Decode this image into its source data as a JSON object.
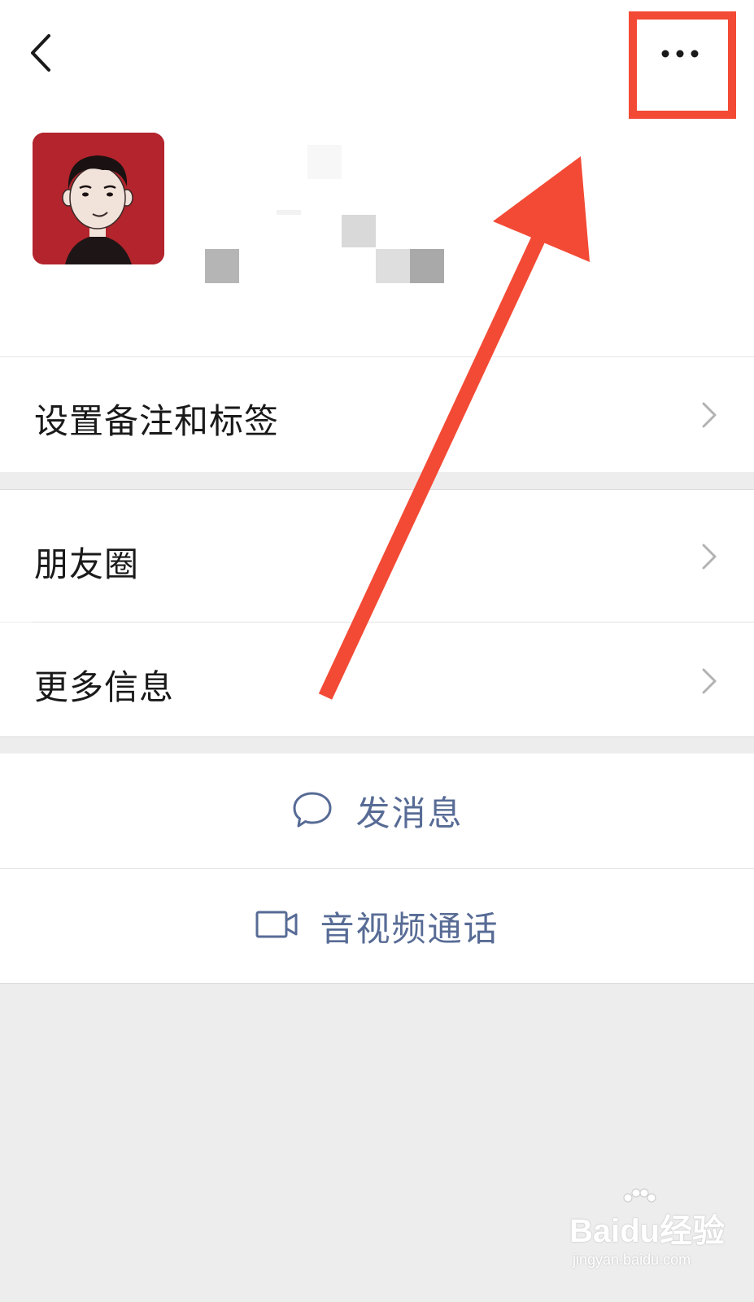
{
  "header": {
    "back_icon": "chevron-left-icon",
    "more_icon": "more-dots-icon"
  },
  "menu": {
    "items": [
      {
        "label": "设置备注和标签",
        "icon": "chevron-right-icon"
      },
      {
        "label": "朋友圈",
        "icon": "chevron-right-icon"
      },
      {
        "label": "更多信息",
        "icon": "chevron-right-icon"
      }
    ]
  },
  "actions": {
    "message": {
      "label": "发消息",
      "icon": "chat-bubble-icon"
    },
    "call": {
      "label": "音视频通话",
      "icon": "video-camera-icon"
    }
  },
  "watermark": {
    "main": "Baidu经验",
    "sub": "jingyan.baidu.com"
  },
  "colors": {
    "highlight": "#f34a35",
    "link": "#576b95",
    "background": "#ededed",
    "avatar_bg": "#b3242c"
  }
}
